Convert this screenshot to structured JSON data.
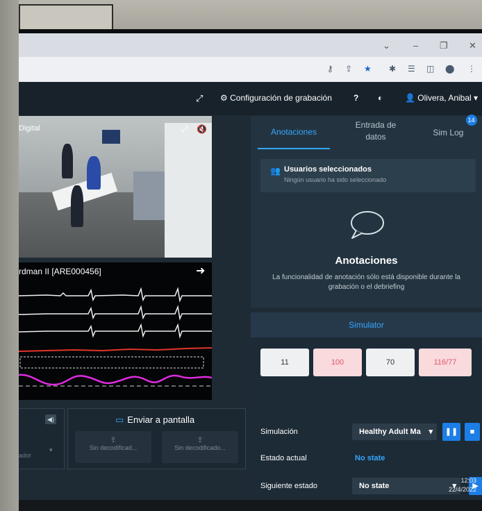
{
  "browser": {
    "window_controls": [
      "⌄",
      "–",
      "❐",
      "✕"
    ]
  },
  "header": {
    "recording_config_label": "Configuración de grabación",
    "help_label": "?",
    "user_label": "Olivera, Anibal"
  },
  "video": {
    "label": "Digital"
  },
  "monitor": {
    "title": "rdman II [ARE000456]"
  },
  "lower": {
    "partial_label": "ador",
    "send_to_screen_label": "Enviar a pantalla",
    "decoder_buttons": [
      "Sin decodificad...",
      "Sin decodificado..."
    ]
  },
  "tabs": {
    "annotations": "Anotaciones",
    "data_entry": "Entrada de datos",
    "sim_log": "Sim Log",
    "sim_log_badge": "14"
  },
  "users": {
    "title": "Usuarios seleccionados",
    "subtitle": "Ningún usuario ha sido seleccionado"
  },
  "annotations": {
    "title": "Anotaciones",
    "description": "La funcionalidad de anotación sólo está disponible durante la grabación o el debriefing"
  },
  "simulator": {
    "header": "Simulator",
    "vitals": [
      "11",
      "100",
      "70",
      "116/77"
    ],
    "simulation_label": "Simulación",
    "simulation_value": "Healthy Adult Ma",
    "current_state_label": "Estado actual",
    "current_state_value": "No state",
    "next_state_label": "Siguiente estado",
    "next_state_value": "No state"
  },
  "clock": {
    "time": "12:03",
    "date": "22/4/2022"
  },
  "colors": {
    "accent": "#35a6ff",
    "panel": "#233440",
    "background": "#1e2b35",
    "alarm_pink": "#f9dadd"
  }
}
